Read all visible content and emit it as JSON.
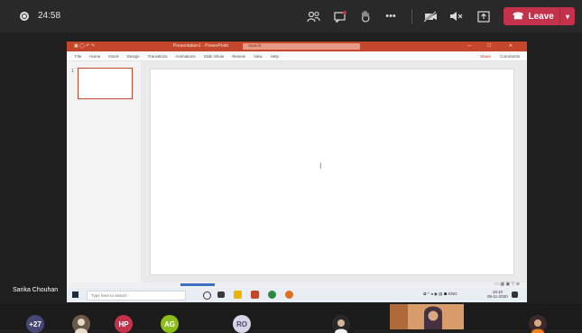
{
  "meeting": {
    "timer": "24:58",
    "leave_label": "Leave"
  },
  "shared_screen": {
    "title": "Presentation1 - PowerPoint",
    "search_placeholder": "Search",
    "ribbon_tabs": [
      "File",
      "Home",
      "Insert",
      "Design",
      "Transitions",
      "Animations",
      "Slide Show",
      "Review",
      "View",
      "Help"
    ],
    "share_label": "Share",
    "comments_label": "Comments",
    "slide_number": "1",
    "taskbar_search": "Type here to search",
    "clock_time": "19:10",
    "clock_date": "09-11-2020",
    "tray_lang": "ENG"
  },
  "presenter_name": "Sarika Chouhan",
  "participants": {
    "more_count": "+27",
    "initials": [
      "HP",
      "AG",
      "RO"
    ]
  },
  "colors": {
    "leave": "#c4314b",
    "ppt_title": "#c4462b",
    "hp": "#c4314b",
    "ag": "#8cbd18",
    "ro": "#d8d4e8",
    "more": "#464775"
  }
}
